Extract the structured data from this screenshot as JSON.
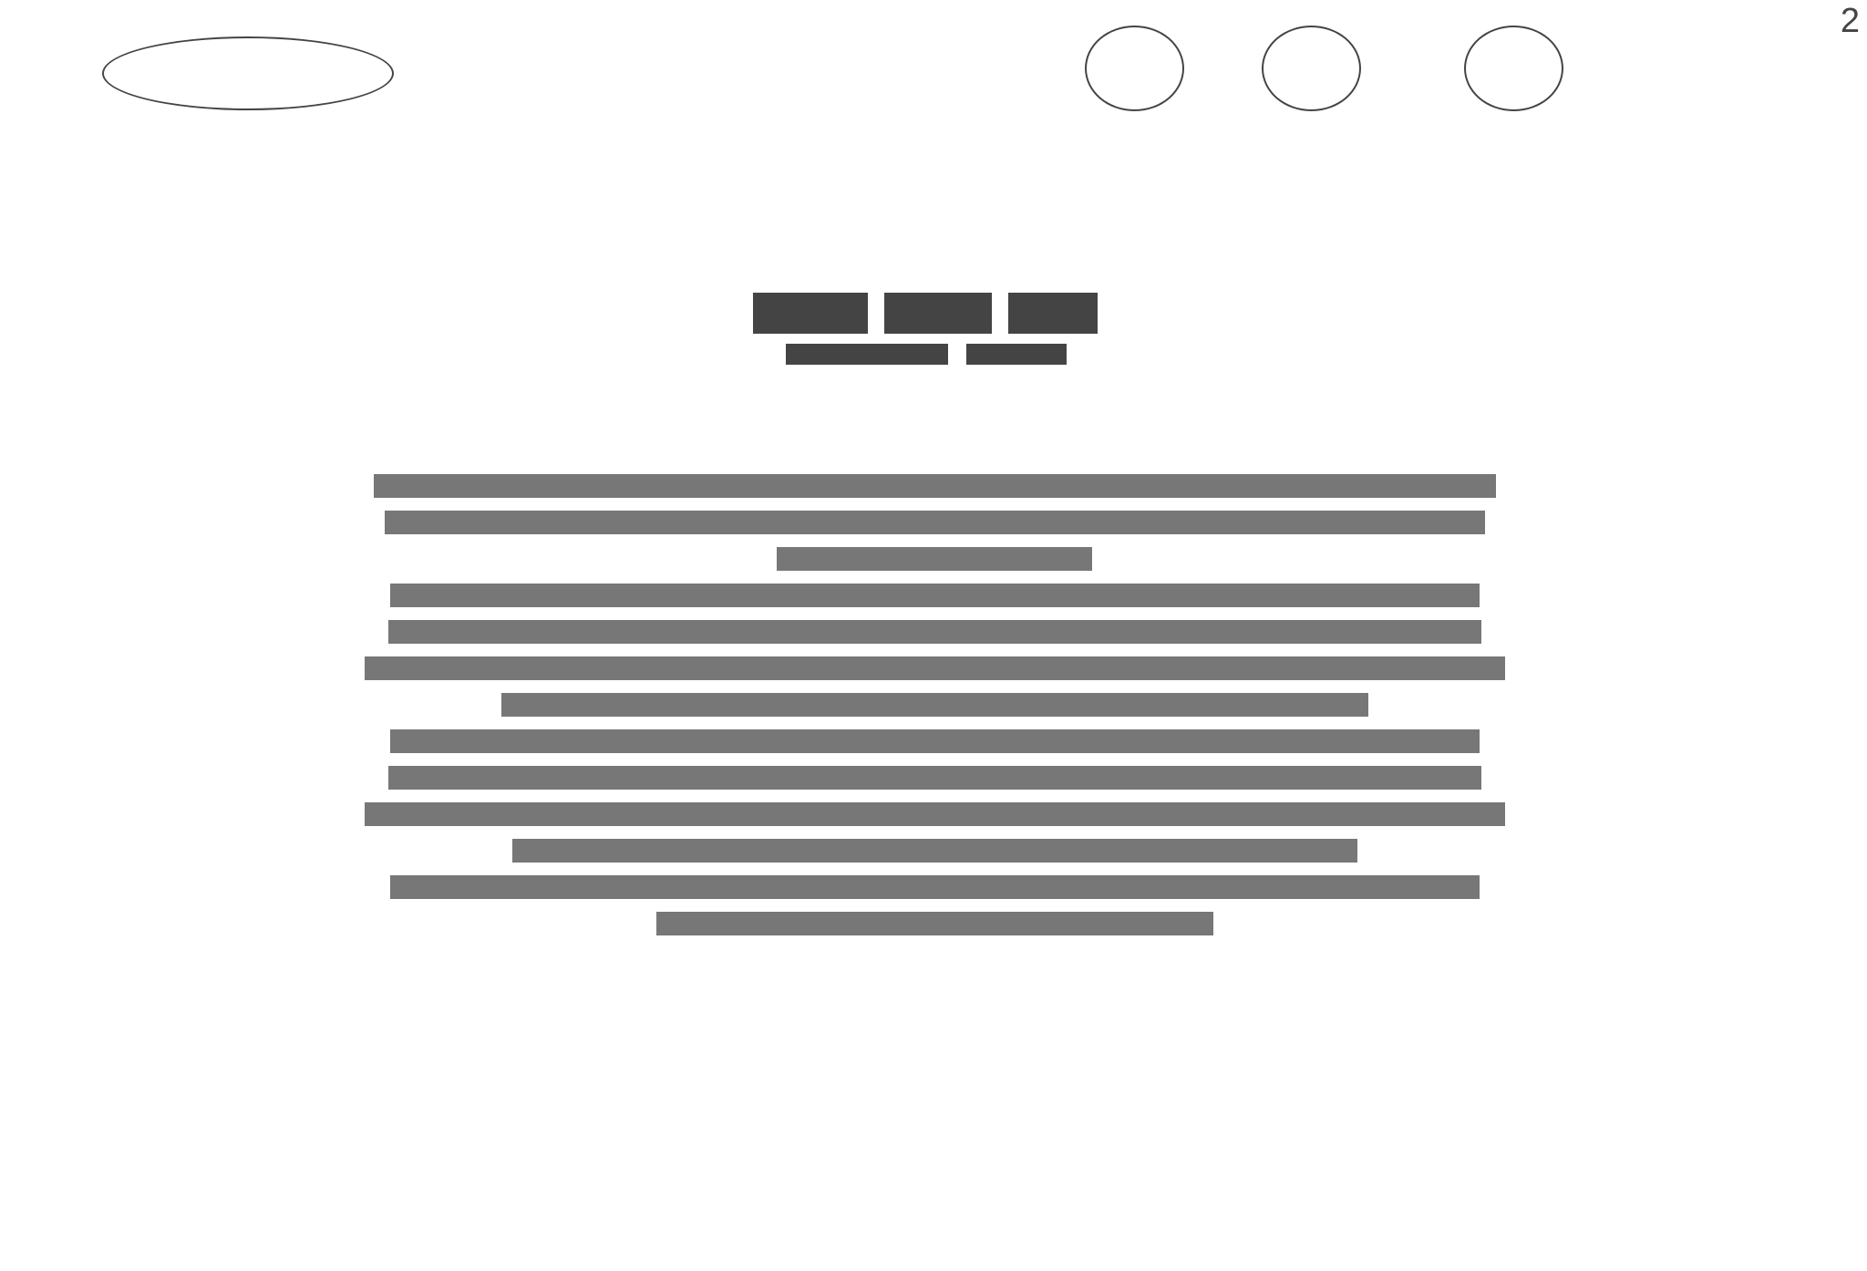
{
  "page": {
    "page_number": "2"
  },
  "header": {
    "logo": "ellipse-placeholder",
    "nav_items": [
      "circle-placeholder",
      "circle-placeholder",
      "circle-placeholder"
    ]
  },
  "heading": {
    "title_word_blocks": 3,
    "subtitle_word_blocks": 2
  },
  "body": {
    "redacted_text_lines": 13
  },
  "colors": {
    "heading_blocks": "#444444",
    "body_text_bars": "#777777",
    "outline": "#444444",
    "background": "#ffffff"
  }
}
